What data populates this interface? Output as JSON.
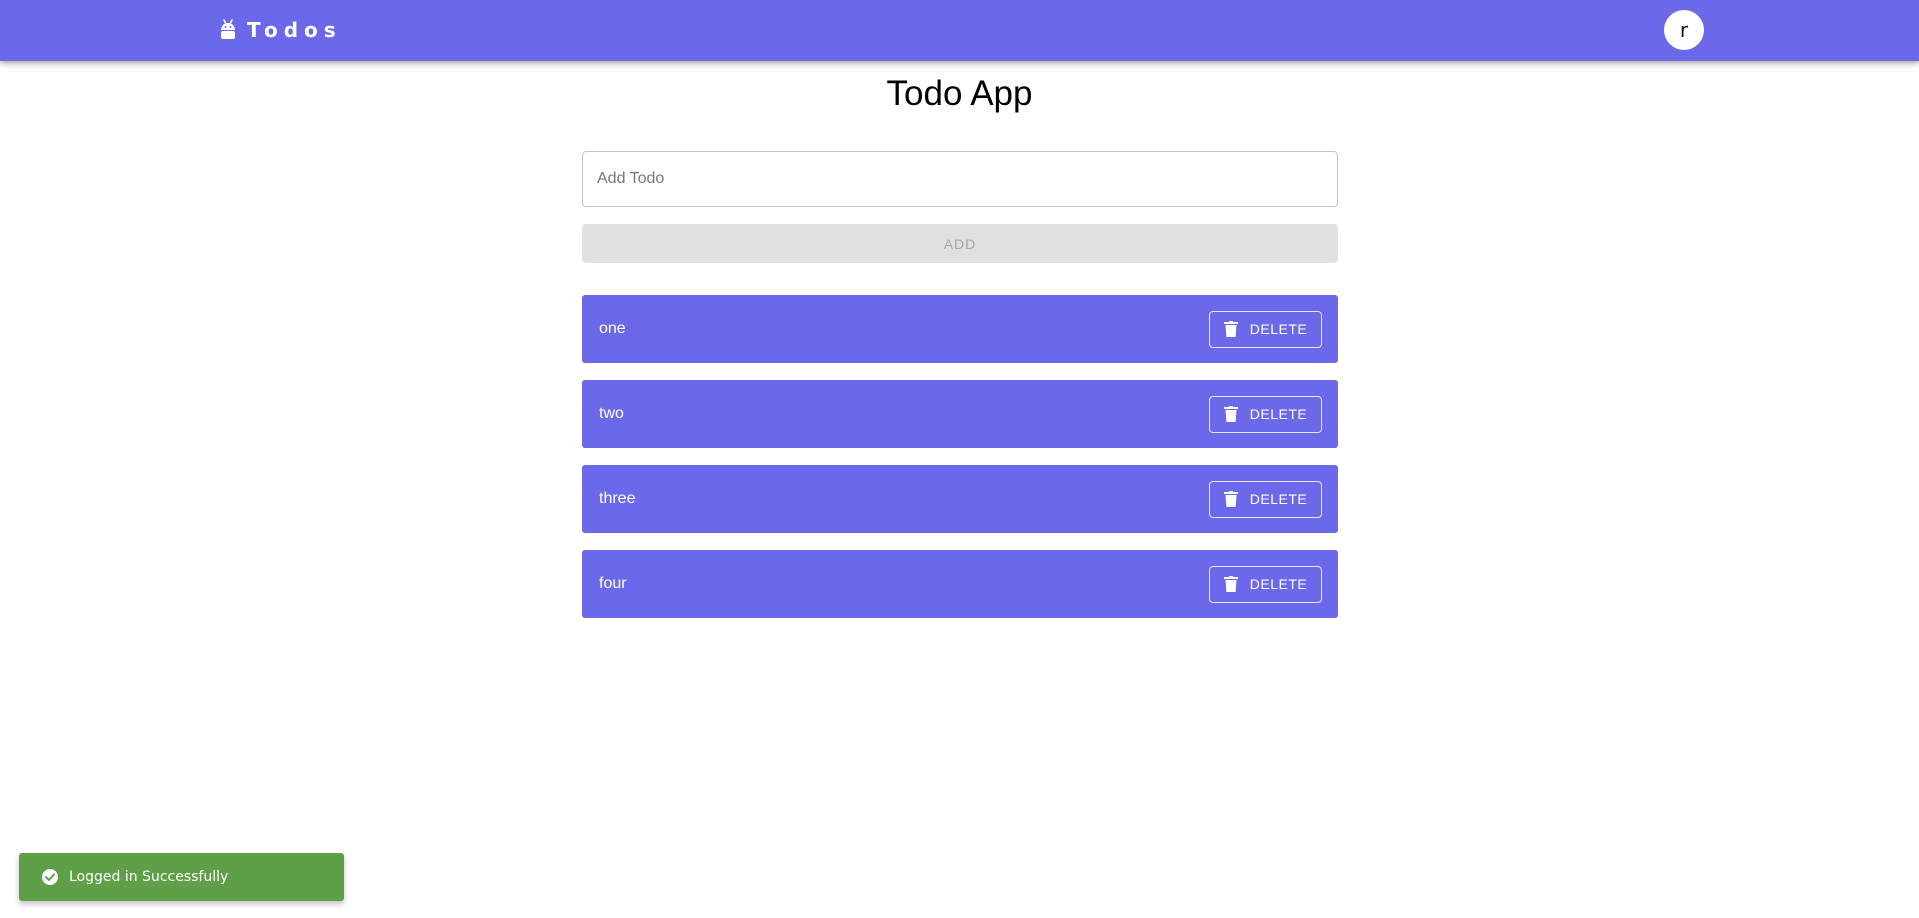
{
  "appbar": {
    "brand_icon": "android-icon",
    "brand_title": "Todos",
    "avatar_letter": "r",
    "color": "#6c68ea"
  },
  "main": {
    "title": "Todo App",
    "input_placeholder": "Add Todo",
    "input_value": "",
    "add_label": "ADD"
  },
  "todos": [
    {
      "text": "one",
      "delete_label": "DELETE",
      "icon": "trash-icon"
    },
    {
      "text": "two",
      "delete_label": "DELETE",
      "icon": "trash-icon"
    },
    {
      "text": "three",
      "delete_label": "DELETE",
      "icon": "trash-icon"
    },
    {
      "text": "four",
      "delete_label": "DELETE",
      "icon": "trash-icon"
    }
  ],
  "toast": {
    "icon": "check-circle-icon",
    "message": "Logged in Successfully",
    "color": "#5f9f48"
  }
}
